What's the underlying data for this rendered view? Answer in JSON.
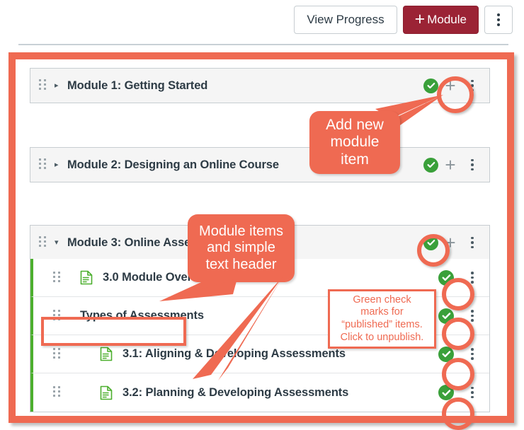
{
  "toolbar": {
    "view_progress_label": "View Progress",
    "add_module_label": "Module",
    "add_module_plus": "+",
    "kebab_name": "more-options"
  },
  "modules": [
    {
      "title": "Module 1: Getting Started",
      "caret": "▸",
      "expanded": false,
      "published": true
    },
    {
      "title": "Module 2: Designing an Online Course",
      "caret": "▸",
      "expanded": false,
      "published": true
    },
    {
      "title": "Module 3: Online Assessment",
      "caret": "▾",
      "expanded": true,
      "published": true
    }
  ],
  "module3_items": [
    {
      "label": "3.0 Module Overview",
      "type": "page",
      "indent": 0,
      "published": true
    },
    {
      "label": "Types of Assessments",
      "type": "text-header",
      "indent": 0,
      "published": true
    },
    {
      "label": "3.1: Aligning & Developing Assessments",
      "type": "page",
      "indent": 1,
      "published": true
    },
    {
      "label": "3.2: Planning & Developing Assessments",
      "type": "page",
      "indent": 1,
      "published": true
    }
  ],
  "annotations": {
    "add_new_module_item": "Add new\nmodule\nitem",
    "add_new_module_item_lines": [
      "Add new",
      "module",
      "item"
    ],
    "module_items_header": "Module items\nand simple\ntext header",
    "module_items_header_lines": [
      "Module items",
      "and simple",
      "text header"
    ],
    "green_check_note_lines": [
      "Green check",
      "marks for",
      "“published” items.",
      "Click to unpublish."
    ],
    "green_check_note": "Green check marks for “published” items. Click to unpublish."
  },
  "colors": {
    "accent_salmon": "#ef6a52",
    "primary_button": "#9b2335",
    "published_green": "#3aa03a",
    "item_border_green": "#4caf2e",
    "text_dark": "#2d3b45"
  }
}
